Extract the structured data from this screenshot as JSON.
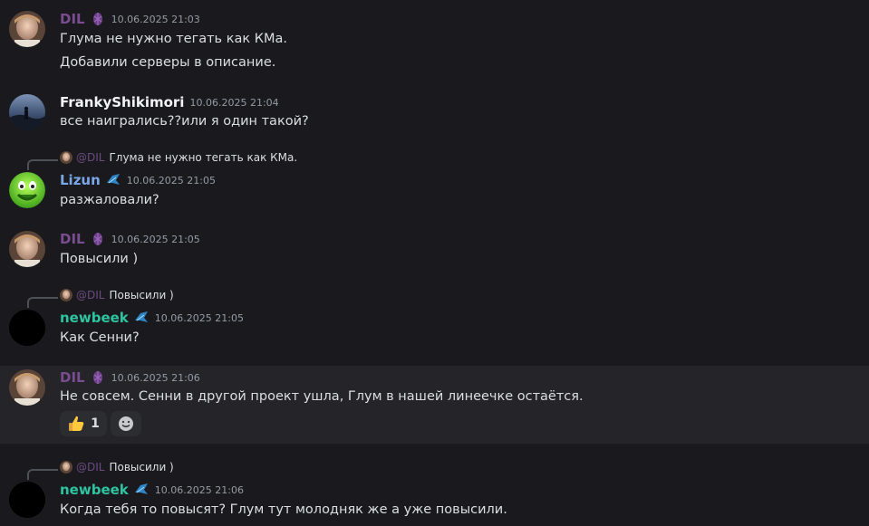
{
  "colors": {
    "dil": "#7a4d91",
    "franky": "#f2f3f5",
    "lizun": "#7aa7e8",
    "newbeek": "#2ec4a0"
  },
  "messages": [
    {
      "author": "DIL",
      "timestamp": "10.06.2025 21:03",
      "lines": [
        "Глума не нужно тегать как КМа.",
        "Добавили серверы в описание."
      ]
    },
    {
      "author": "FrankyShikimori",
      "timestamp": "10.06.2025 21:04",
      "lines": [
        "все наигрались??или я один такой?"
      ]
    },
    {
      "reply": {
        "mention": "@DIL",
        "text": "Глума не нужно тегать как КМа."
      },
      "author": "Lizun",
      "timestamp": "10.06.2025 21:05",
      "lines": [
        "разжаловали?"
      ]
    },
    {
      "author": "DIL",
      "timestamp": "10.06.2025 21:05",
      "lines": [
        "Повысили )"
      ]
    },
    {
      "reply": {
        "mention": "@DIL",
        "text": "Повысили )"
      },
      "author": "newbeek",
      "timestamp": "10.06.2025 21:05",
      "lines": [
        "Как Сенни?"
      ]
    },
    {
      "author": "DIL",
      "timestamp": "10.06.2025 21:06",
      "lines": [
        "Не совсем. Сенни в другой проект ушла, Глум в нашей линеечке остаётся."
      ],
      "reactions": [
        {
          "emoji": "thumbs-up",
          "count": "1"
        },
        {
          "emoji": "add-reaction"
        }
      ]
    },
    {
      "reply": {
        "mention": "@DIL",
        "text": "Повысили )"
      },
      "author": "newbeek",
      "timestamp": "10.06.2025 21:06",
      "lines": [
        "Когда тебя то повысят? Глум тут молодняк же а уже повысили."
      ]
    }
  ]
}
